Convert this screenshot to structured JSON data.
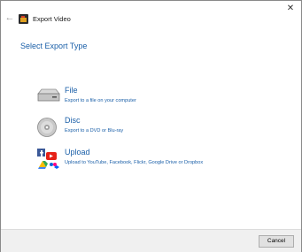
{
  "window": {
    "title": "Export Video",
    "back_icon": "back-arrow-icon",
    "close_icon": "close-icon",
    "back_glyph": "←",
    "close_glyph": "✕"
  },
  "heading": "Select Export Type",
  "options": [
    {
      "icon": "hard-drive-icon",
      "title": "File",
      "description": "Export to a file on your computer"
    },
    {
      "icon": "disc-icon",
      "title": "Disc",
      "description": "Export to a DVD or Blu-ray"
    },
    {
      "icon": "upload-services-icon",
      "title": "Upload",
      "description": "Upload to YouTube, Facebook, Flickr, Google Drive or Dropbox"
    }
  ],
  "footer": {
    "cancel_label": "Cancel"
  },
  "colors": {
    "accent": "#1a5fa8",
    "footer_bg": "#f0f0f0",
    "button_bg": "#e1e1e1"
  }
}
